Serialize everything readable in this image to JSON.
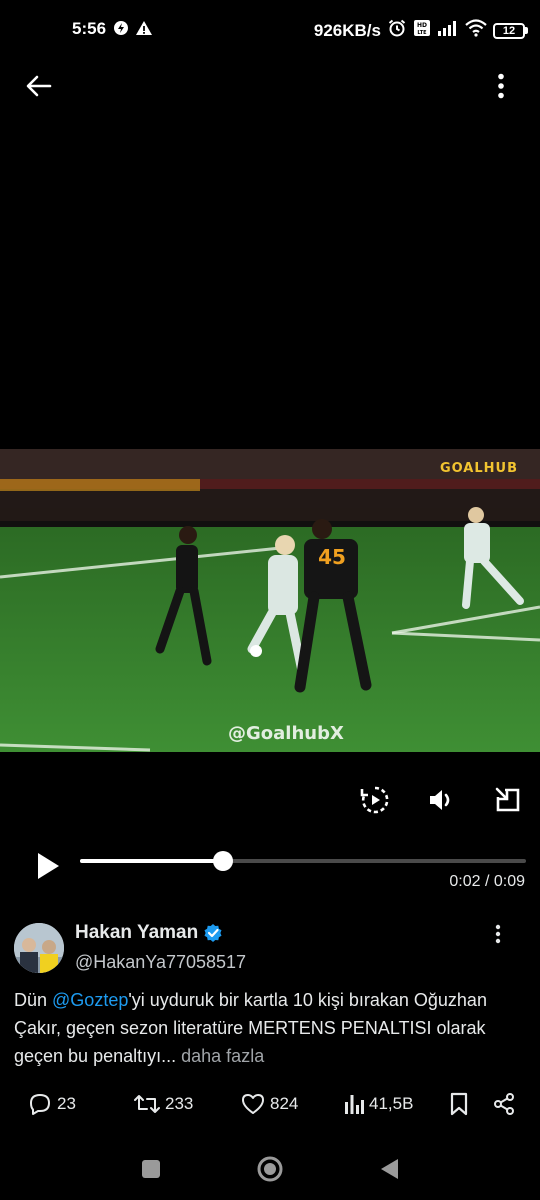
{
  "status_bar": {
    "time": "5:56",
    "network_speed": "926KB/s",
    "battery_level": "12",
    "icons": [
      "data-saver-icon",
      "warning-icon",
      "alarm-icon",
      "volte-icon",
      "signal-icon",
      "wifi-icon",
      "battery-icon"
    ]
  },
  "nav": {
    "back_icon": "arrow-left-icon",
    "more_icon": "more-vertical-icon"
  },
  "video": {
    "channel_logo": "GOALHUB",
    "watermark": "@GoalhubX",
    "player_number": "45",
    "controls": [
      "replay-icon",
      "volume-icon",
      "minimize-icon"
    ],
    "current_time": "0:02",
    "duration": "0:09",
    "time_display": "0:02 / 0:09",
    "progress_fraction": 0.32
  },
  "tweet": {
    "author_name": "Hakan Yaman",
    "verified": true,
    "handle": "@HakanYa77058517",
    "text_pre": "Dün ",
    "mention": "@Goztep",
    "text_post": "'yi uyduruk bir kartla 10 kişi bırakan Oğuzhan Çakır, geçen sezon literatüre MERTENS PENALTISI olarak geçen bu penaltıyı...",
    "more_link": "daha fazla"
  },
  "actions": {
    "replies": "23",
    "retweets": "233",
    "likes": "824",
    "views": "41,5B"
  },
  "colors": {
    "background": "#000000",
    "accent": "#1d9bf0",
    "text": "#e7e9ea",
    "muted": "#c4c8cc"
  }
}
